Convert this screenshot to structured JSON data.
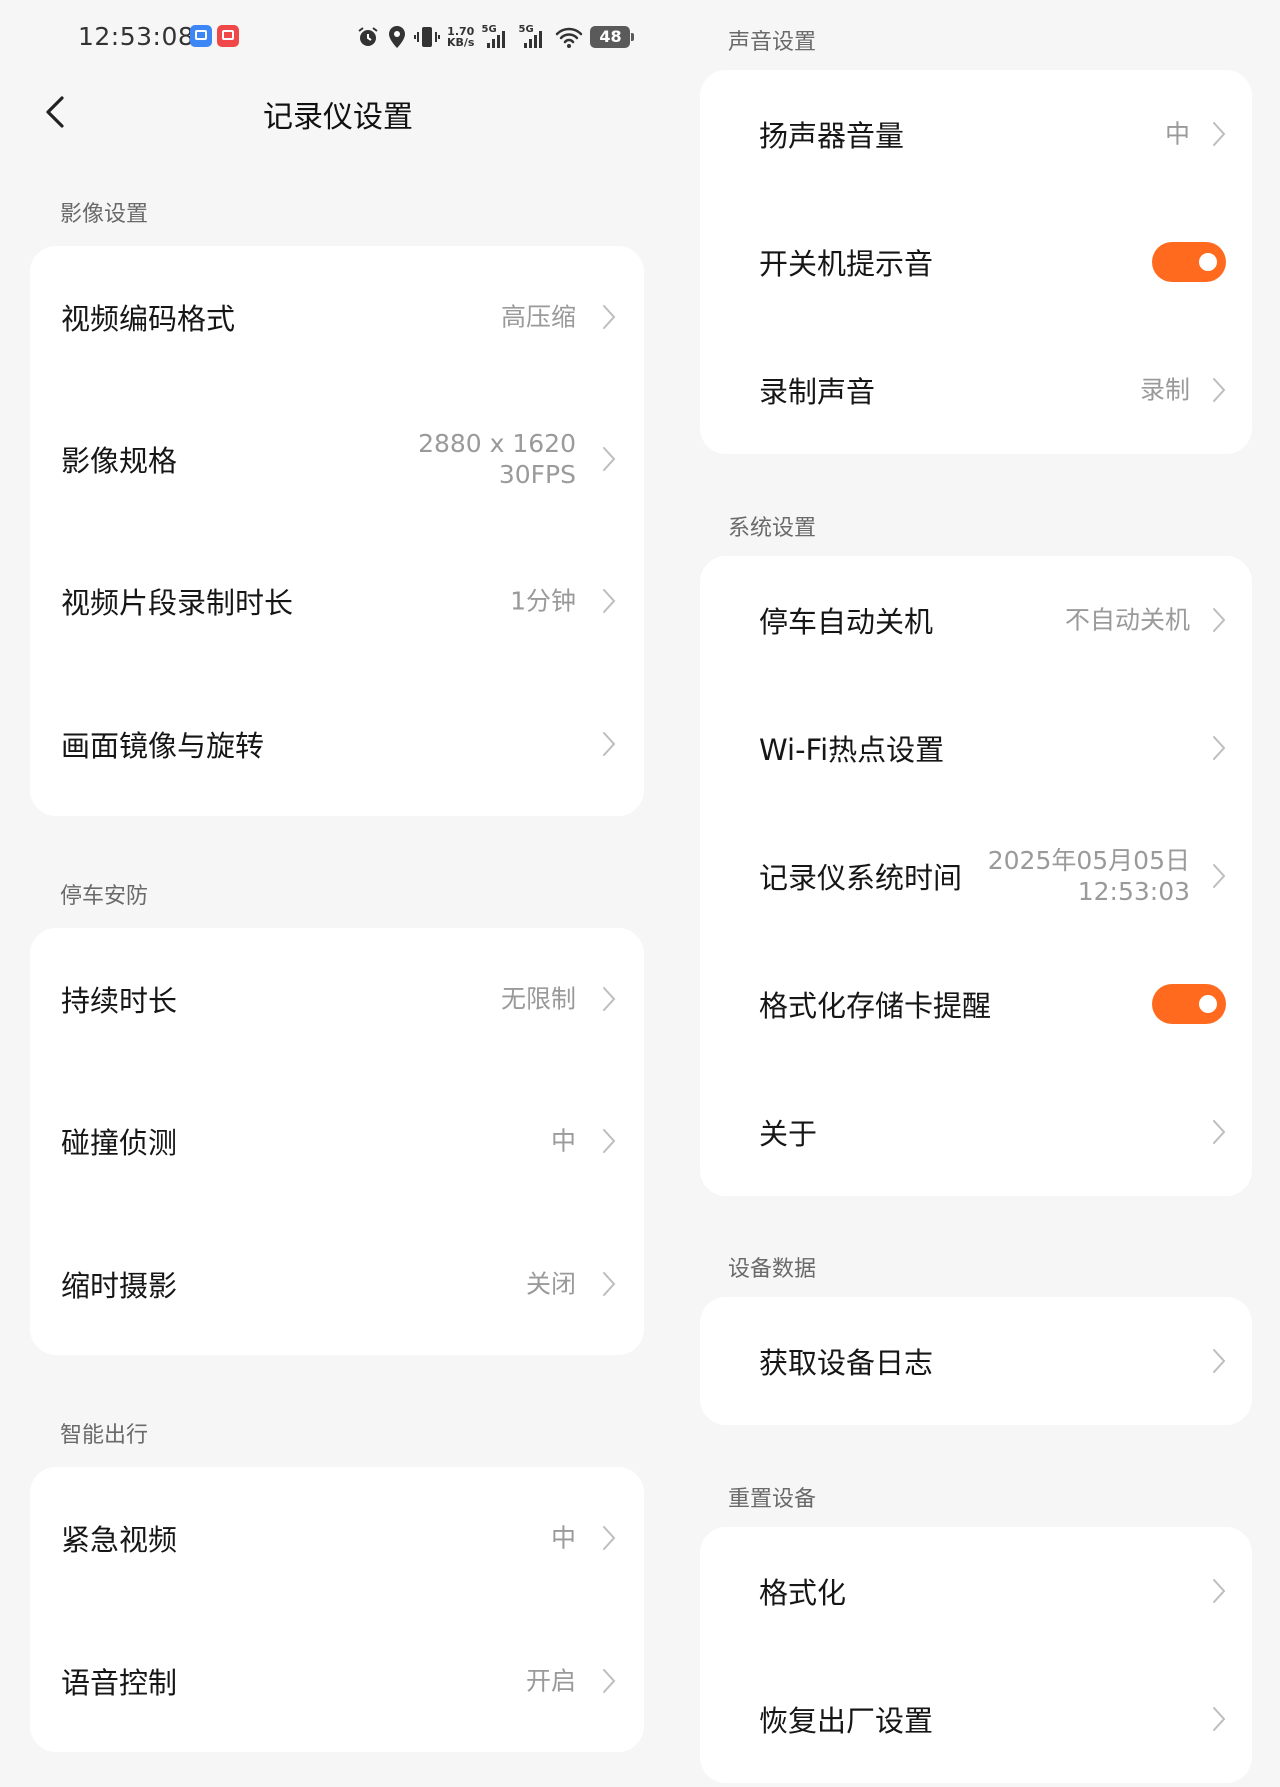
{
  "status_bar": {
    "time": "12:53:08",
    "net_speed_value": "1.70",
    "net_speed_unit": "KB/s",
    "sim1_type": "5G",
    "sim2_type": "5G",
    "battery": "48",
    "icons": [
      "app-icon-1",
      "app-icon-2",
      "alarm-icon",
      "location-icon",
      "vibrate-icon",
      "signal-icon",
      "wifi-icon",
      "battery-icon"
    ]
  },
  "header": {
    "title": "记录仪设置",
    "back_icon": "chevron-left-icon"
  },
  "video": {
    "label": "影像设置",
    "items": [
      {
        "title": "视频编码格式",
        "value": "高压缩"
      },
      {
        "title": "影像规格",
        "value_line1": "2880 x 1620",
        "value_line2": "30FPS"
      },
      {
        "title": "视频片段录制时长",
        "value": "1分钟"
      },
      {
        "title": "画面镜像与旋转"
      }
    ]
  },
  "parking": {
    "label": "停车安防",
    "items": [
      {
        "title": "持续时长",
        "value": "无限制"
      },
      {
        "title": "碰撞侦测",
        "value": "中"
      },
      {
        "title": "缩时摄影",
        "value": "关闭"
      }
    ]
  },
  "smart": {
    "label": "智能出行",
    "items": [
      {
        "title": "紧急视频",
        "value": "中"
      },
      {
        "title": "语音控制",
        "value": "开启"
      }
    ]
  },
  "sound": {
    "label": "声音设置",
    "items": [
      {
        "title": "扬声器音量",
        "value": "中"
      },
      {
        "title": "开关机提示音",
        "toggle": true
      },
      {
        "title": "录制声音",
        "value": "录制"
      }
    ]
  },
  "system": {
    "label": "系统设置",
    "items": [
      {
        "title": "停车自动关机",
        "value": "不自动关机"
      },
      {
        "title": "Wi-Fi热点设置"
      },
      {
        "title": "记录仪系统时间",
        "value_line1": "2025年05月05日",
        "value_line2": "12:53:03"
      },
      {
        "title": "格式化存储卡提醒",
        "toggle": true
      },
      {
        "title": "关于"
      }
    ]
  },
  "device_data": {
    "label": "设备数据",
    "items": [
      {
        "title": "获取设备日志"
      }
    ]
  },
  "reset": {
    "label": "重置设备",
    "items": [
      {
        "title": "格式化"
      },
      {
        "title": "恢复出厂设置"
      }
    ]
  },
  "colors": {
    "accent": "#ff6a1f",
    "background": "#f6f6f6",
    "card": "#ffffff",
    "secondary_text": "#9a9a9a"
  }
}
